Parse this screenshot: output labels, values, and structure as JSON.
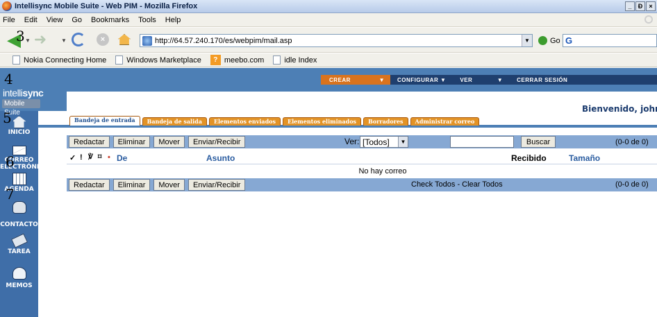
{
  "window": {
    "title": "Intellisync Mobile Suite - Web PIM - Mozilla Firefox",
    "controls": [
      "_",
      "Đ",
      "×"
    ]
  },
  "menubar": [
    "File",
    "Edit",
    "View",
    "Go",
    "Bookmarks",
    "Tools",
    "Help"
  ],
  "navbar": {
    "url": "http://64.57.240.170/es/webpim/mail.asp",
    "go_label": "Go",
    "search_glyph": "G"
  },
  "bookmarks": [
    {
      "label": "Nokia Connecting Home",
      "icon": "page-icon"
    },
    {
      "label": "Windows Marketplace",
      "icon": "page-icon"
    },
    {
      "label": "meebo.com",
      "icon": "meebo-icon"
    },
    {
      "label": "idle Index",
      "icon": "page-icon"
    }
  ],
  "app": {
    "brand_top": "intelli",
    "brand_main": "intellisync",
    "brand_sub": "Mobile Suite",
    "top_menu": [
      "CREAR",
      "CONFIGURAR",
      "VER",
      "CERRAR SESIÓN"
    ],
    "welcome": "Bienvenido, john smith"
  },
  "sidebar": [
    {
      "label": "INICIO",
      "icon": "home-icon"
    },
    {
      "label": "CORREO ELECTRÓNICO",
      "icon": "mail-icon"
    },
    {
      "label": "AGENDA",
      "icon": "calendar-icon"
    },
    {
      "label": "CONTACTO",
      "icon": "contact-icon"
    },
    {
      "label": "TAREA",
      "icon": "task-icon"
    },
    {
      "label": "MEMOS",
      "icon": "memo-icon"
    }
  ],
  "annotations": [
    "3",
    "4",
    "5",
    "6",
    "7"
  ],
  "tabs": [
    {
      "label": "Bandeja de entrada",
      "active": true
    },
    {
      "label": "Bandeja de salida",
      "active": false
    },
    {
      "label": "Elementos enviados",
      "active": false
    },
    {
      "label": "Elementos eliminados",
      "active": false
    },
    {
      "label": "Borradores",
      "active": false
    },
    {
      "label": "Administrar correo",
      "active": false
    }
  ],
  "toolbar": {
    "compose": "Redactar",
    "delete": "Eliminar",
    "move": "Mover",
    "send_receive": "Enviar/Recibir",
    "view_label": "Ver:",
    "view_value": "[Todos]",
    "search": "Buscar",
    "count": "(0-0 de 0)"
  },
  "table": {
    "icons": [
      "✓",
      "!",
      "🗑",
      "📎",
      "•"
    ],
    "col_from": "De",
    "col_subject": "Asunto",
    "col_received": "Recibido",
    "col_size": "Tamaño",
    "empty": "No hay correo"
  },
  "bottom": {
    "check_links": "Check Todos - Clear Todos",
    "count": "(0-0 de 0)"
  }
}
